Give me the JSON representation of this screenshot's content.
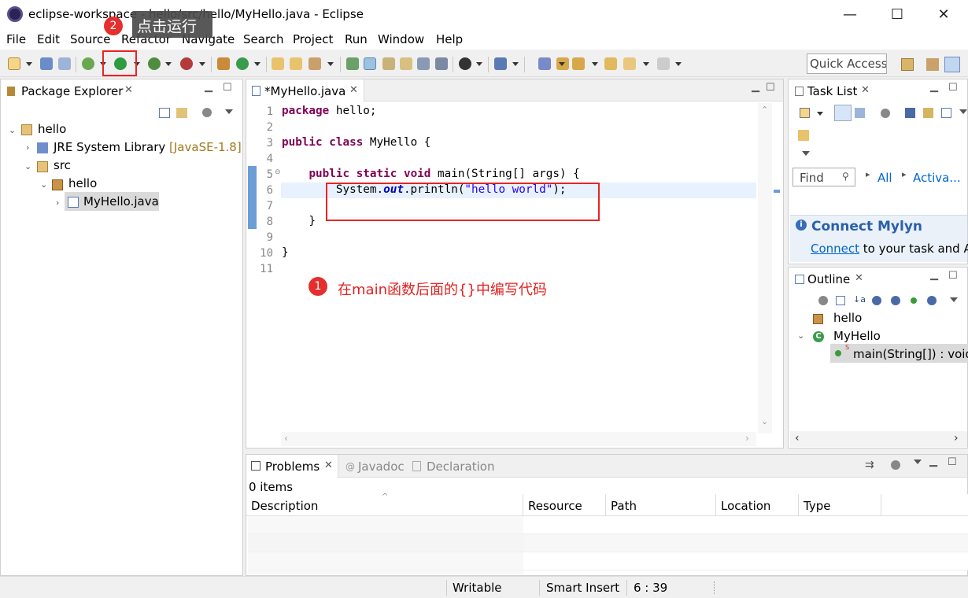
{
  "window": {
    "title": "eclipse-workspace - hello/src/hello/MyHello.java - Eclipse",
    "minimize": "—",
    "maximize": "☐",
    "close": "✕"
  },
  "menu": [
    "File",
    "Edit",
    "Source",
    "Refactor",
    "Navigate",
    "Search",
    "Project",
    "Run",
    "Window",
    "Help"
  ],
  "toolbar": {
    "quick_access": "Quick Access"
  },
  "package_explorer": {
    "tab": "Package Explorer",
    "tree": {
      "project": "hello",
      "jre": "JRE System Library",
      "jre_version": "[JavaSE-1.8]",
      "src": "src",
      "package": "hello",
      "file": "MyHello.java"
    }
  },
  "editor": {
    "tab": "*MyHello.java",
    "line_numbers": [
      "1",
      "2",
      "3",
      "4",
      "5",
      "6",
      "7",
      "8",
      "9",
      "10",
      "11"
    ]
  },
  "task_list": {
    "tab": "Task List",
    "find_placeholder": "Find",
    "filter_all": "All",
    "filter_activate": "Activa...",
    "mylyn_title": "Connect Mylyn",
    "mylyn_link": "Connect",
    "mylyn_text": " to your task and A"
  },
  "outline": {
    "tab": "Outline",
    "package": "hello",
    "class": "MyHello",
    "method": "main(String[]) : void"
  },
  "bottom": {
    "tabs": {
      "problems": "Problems",
      "javadoc": "Javadoc",
      "declaration": "Declaration"
    },
    "count": "0 items",
    "columns": [
      "Description",
      "Resource",
      "Path",
      "Location",
      "Type"
    ]
  },
  "status": {
    "writable": "Writable",
    "insert": "Smart Insert",
    "position": "6 : 39"
  },
  "annotations": {
    "step1_num": "1",
    "step1_text": "在main函数后面的{}中编写代码",
    "step2_num": "2",
    "step2_text": "点击运行"
  },
  "colors": {
    "accent": "#0066cc",
    "annotation": "#e22222",
    "keyword": "#7f0055",
    "string": "#2a00ff"
  }
}
